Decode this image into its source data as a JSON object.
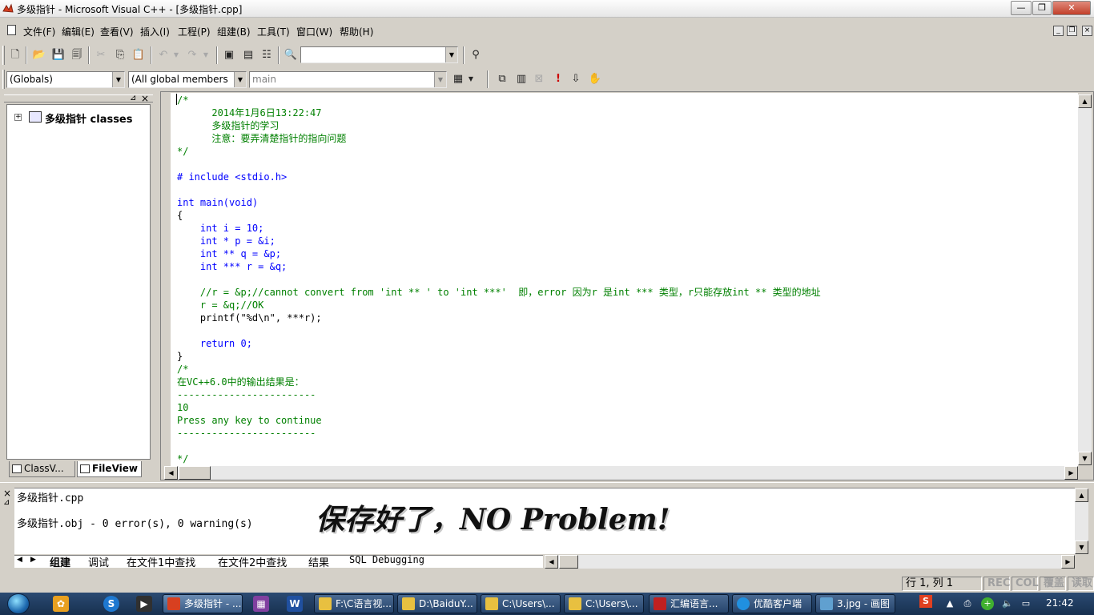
{
  "window": {
    "title": "多级指针 - Microsoft Visual C++ - [多级指针.cpp]",
    "min_icon": "minimize-icon",
    "max_icon": "maximize-icon",
    "close_icon": "close-icon"
  },
  "menu": {
    "items": [
      "文件(F)",
      "编辑(E)",
      "查看(V)",
      "插入(I)",
      "工程(P)",
      "组建(B)",
      "工具(T)",
      "窗口(W)",
      "帮助(H)"
    ],
    "mdi_min": "_",
    "mdi_restore": "❐",
    "mdi_close": "×"
  },
  "toolbar": {
    "find_combo_value": "",
    "globals_combo": "(Globals)",
    "members_combo": "(All global members",
    "function_combo": "main"
  },
  "workspace": {
    "tree_root": "多级指针 classes",
    "tabs": [
      "ClassV...",
      "FileView"
    ]
  },
  "editor": {
    "lines": [
      {
        "cls": "cm",
        "text": "/*"
      },
      {
        "cls": "cm",
        "text": "      2014年1月6日13:22:47"
      },
      {
        "cls": "cm",
        "text": "      多级指针的学习"
      },
      {
        "cls": "cm",
        "text": "      注意：要弄清楚指针的指向问题"
      },
      {
        "cls": "cm",
        "text": "*/"
      },
      {
        "cls": "pl",
        "text": ""
      },
      {
        "cls": "kw",
        "text": "# include <stdio.h>"
      },
      {
        "cls": "pl",
        "text": ""
      },
      {
        "cls": "kw",
        "text": "int main(void)"
      },
      {
        "cls": "pl",
        "text": "{"
      },
      {
        "cls": "kw",
        "text": "    int i = 10;"
      },
      {
        "cls": "kw",
        "text": "    int * p = &i;"
      },
      {
        "cls": "kw",
        "text": "    int ** q = &p;"
      },
      {
        "cls": "kw",
        "text": "    int *** r = &q;"
      },
      {
        "cls": "pl",
        "text": ""
      },
      {
        "cls": "cm",
        "text": "    //r = &p;//cannot convert from 'int ** ' to 'int ***'  即，error 因为r 是int *** 类型，r只能存放int ** 类型的地址"
      },
      {
        "cls": "cm",
        "text": "    r = &q;//OK"
      },
      {
        "cls": "pl",
        "text": "    printf(\"%d\\n\", ***r);"
      },
      {
        "cls": "pl",
        "text": ""
      },
      {
        "cls": "kw",
        "text": "    return 0;"
      },
      {
        "cls": "pl",
        "text": "}"
      },
      {
        "cls": "cm",
        "text": "/*"
      },
      {
        "cls": "cm",
        "text": "在VC++6.0中的输出结果是："
      },
      {
        "cls": "cm",
        "text": "------------------------"
      },
      {
        "cls": "cm",
        "text": "10"
      },
      {
        "cls": "cm",
        "text": "Press any key to continue"
      },
      {
        "cls": "cm",
        "text": "------------------------"
      },
      {
        "cls": "pl",
        "text": ""
      },
      {
        "cls": "cm",
        "text": "*/"
      }
    ]
  },
  "output": {
    "lines": [
      "多级指针.cpp",
      "多级指针.obj - 0 error(s), 0 warning(s)"
    ],
    "overlay_text": "保存好了，NO Problem!",
    "tabs": [
      "组建",
      "调试",
      "在文件1中查找",
      "在文件2中查找",
      "结果",
      "SQL Debugging"
    ]
  },
  "status": {
    "position": "行 1, 列 1",
    "rec": "REC",
    "col": "COL",
    "ovr": "覆盖",
    "read": "读取"
  },
  "taskbar": {
    "items": [
      "多级指针 - ...",
      "F:\\C语言视...",
      "D:\\BaiduY...",
      "C:\\Users\\...",
      "C:\\Users\\...",
      "汇编语言...",
      "优酷客户端",
      "3.jpg - 画图"
    ],
    "clock": "21:42"
  },
  "colors": {
    "comment": "#008000",
    "keyword": "#0000ff",
    "taskbar": "#1f3a5e"
  }
}
